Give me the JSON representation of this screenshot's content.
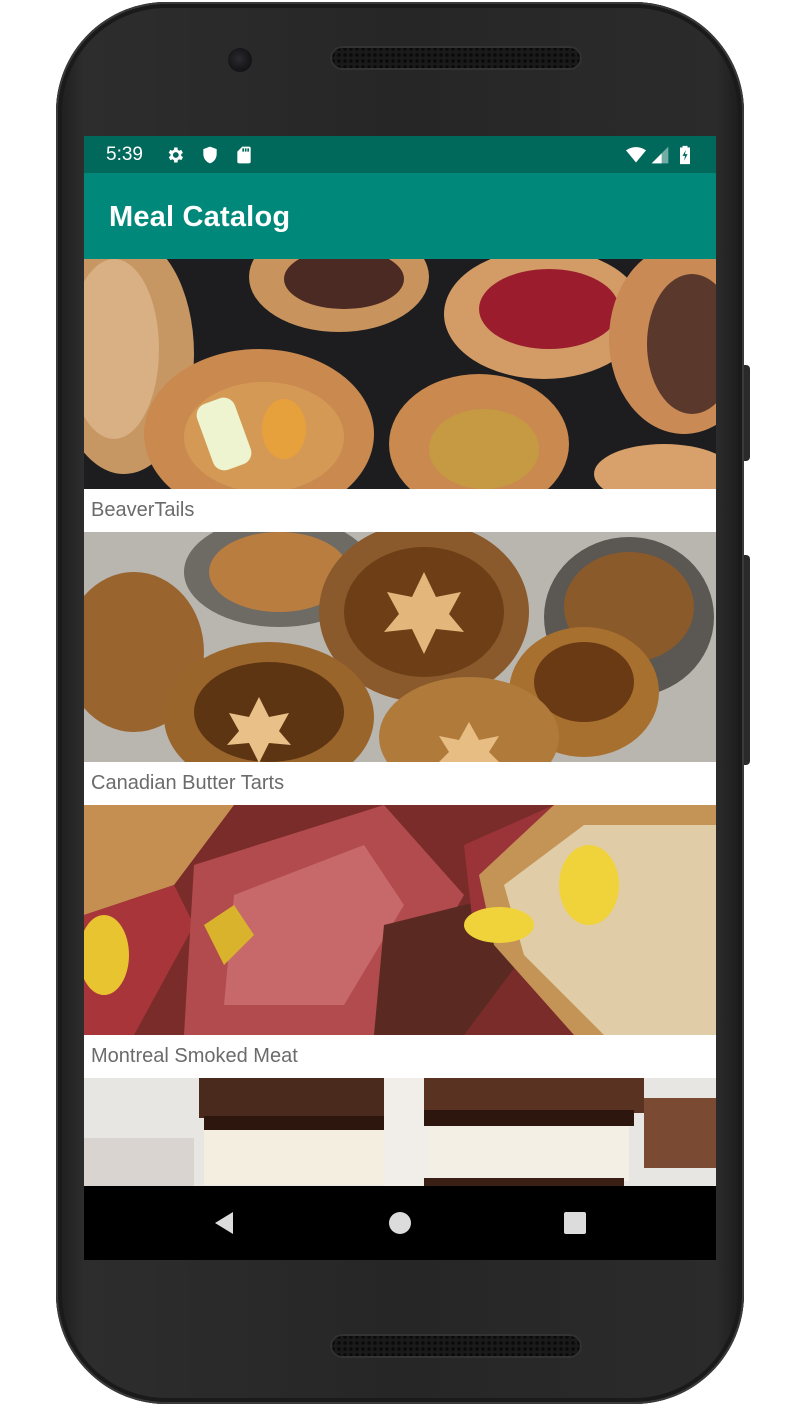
{
  "status_bar": {
    "time": "5:39",
    "left_icons": [
      "settings-icon",
      "shield-icon",
      "sd-card-icon"
    ],
    "right_icons": [
      "wifi-icon",
      "signal-icon",
      "battery-icon"
    ]
  },
  "app_bar": {
    "title": "Meal Catalog",
    "color": "#00897b",
    "status_color": "#00695c"
  },
  "meals": [
    {
      "name": "BeaverTails"
    },
    {
      "name": "Canadian Butter Tarts"
    },
    {
      "name": "Montreal Smoked Meat"
    },
    {
      "name": ""
    }
  ],
  "nav_bar": {
    "buttons": [
      "back-icon",
      "home-icon",
      "recents-icon"
    ]
  }
}
